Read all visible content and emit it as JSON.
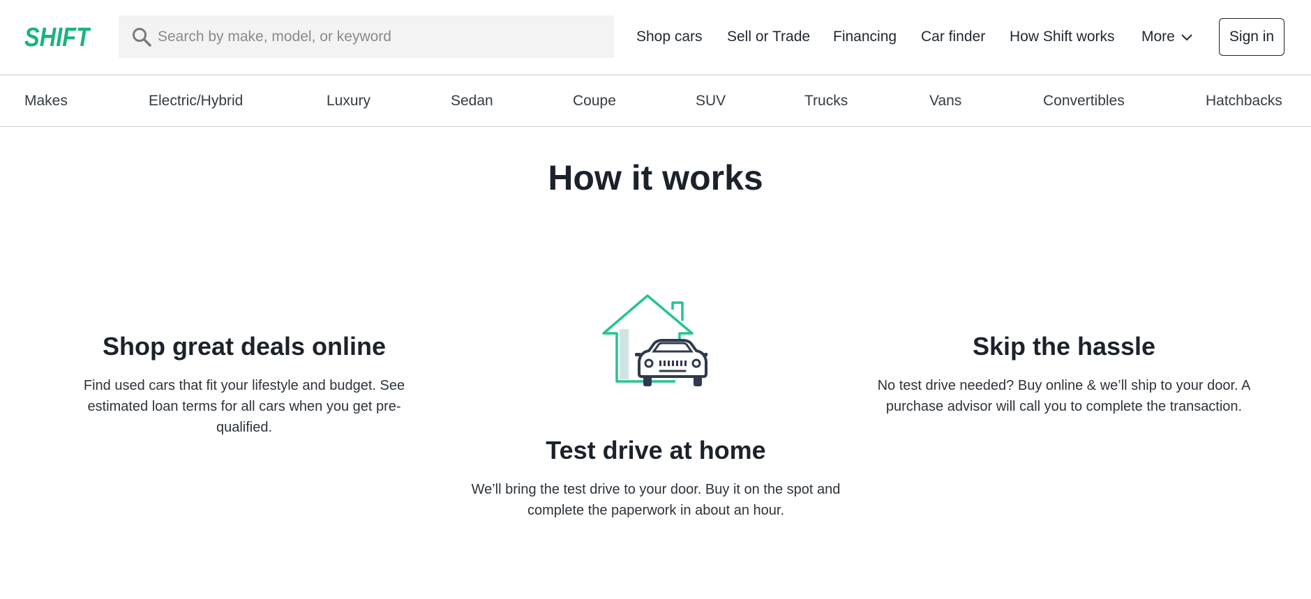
{
  "header": {
    "logo_text": "SHIFT",
    "search_placeholder": "Search by make, model, or keyword",
    "nav": [
      {
        "label": "Shop cars"
      },
      {
        "label": "Sell or Trade"
      },
      {
        "label": "Financing"
      },
      {
        "label": "Car finder"
      },
      {
        "label": "How Shift works"
      },
      {
        "label": "More"
      }
    ],
    "signin_label": "Sign in"
  },
  "categories": [
    "Makes",
    "Electric/Hybrid",
    "Luxury",
    "Sedan",
    "Coupe",
    "SUV",
    "Trucks",
    "Vans",
    "Convertibles",
    "Hatchbacks"
  ],
  "main": {
    "title": "How it works",
    "features": [
      {
        "title": "Shop great deals online",
        "text": "Find used cars that fit your lifestyle and budget. See estimated loan terms for all cars when you get pre-qualified."
      },
      {
        "title": "Test drive at home",
        "text": "We’ll bring the test drive to your door. Buy it on the spot and complete the paperwork in about an hour.",
        "icon": "house-car-icon"
      },
      {
        "title": "Skip the hassle",
        "text": "No test drive needed? Buy online & we’ll ship to your door. A purchase advisor will call you to complete the transaction."
      }
    ]
  },
  "colors": {
    "brand_green": "#19b37e",
    "text_dark": "#1b222b",
    "search_bg": "#f3f3f3",
    "divider": "#cfcfcf"
  }
}
